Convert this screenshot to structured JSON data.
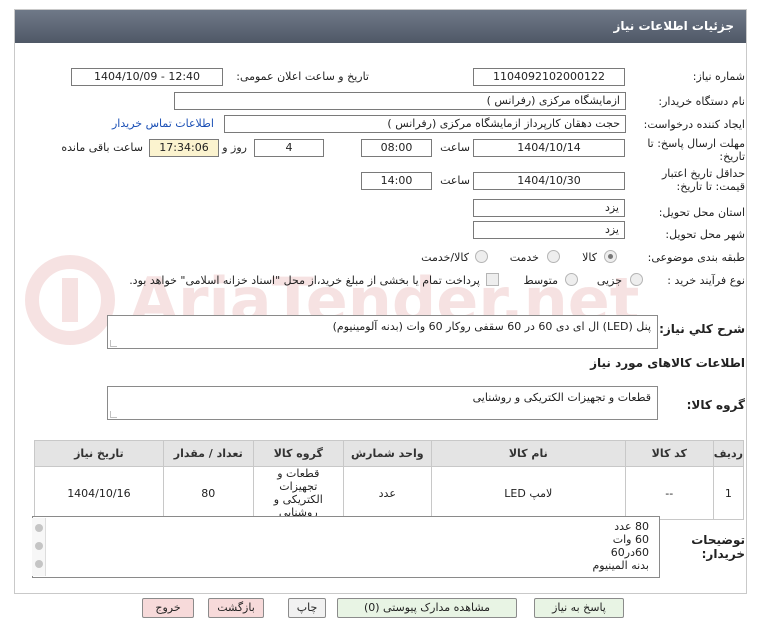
{
  "header": {
    "title": "جزئیات اطلاعات نیاز"
  },
  "form": {
    "need_number_label": "شماره نیاز:",
    "need_number": "1104092102000122",
    "announce_label": "تاریخ و ساعت اعلان عمومی:",
    "announce_value": "1404/10/09 - 12:40",
    "buyer_org_label": "نام دستگاه خریدار:",
    "buyer_org": "ازمایشگاه مرکزی (رفرانس )",
    "creator_label": "ایجاد کننده درخواست:",
    "creator": "حجت دهقان کارپرداز ازمایشگاه مرکزی (رفرانس )",
    "contact_link": "اطلاعات تماس خریدار",
    "deadline_label_1": "مهلت ارسال پاسخ: تا",
    "deadline_label_2": "تاریخ:",
    "deadline_date": "1404/10/14",
    "time_label": "ساعت",
    "deadline_time": "08:00",
    "days_value": "4",
    "days_label": "روز و",
    "remaining_time": "17:34:06",
    "remaining_label": "ساعت باقی مانده",
    "validity_label_1": "حداقل تاریخ اعتبار",
    "validity_label_2": "قیمت: تا تاریخ:",
    "validity_date": "1404/10/30",
    "validity_time_label": "ساعت",
    "validity_time": "14:00",
    "province_label": "استان محل تحویل:",
    "province": "یزد",
    "city_label": "شهر محل تحویل:",
    "city": "یزد",
    "category_label": "طبقه بندی موضوعی:",
    "category_options": [
      "کالا",
      "خدمت",
      "کالا/خدمت"
    ],
    "category_selected": "کالا",
    "purchase_label": "نوع فرآیند خرید :",
    "purchase_options": [
      "جزیی",
      "متوسط"
    ],
    "purchase_note": "پرداخت تمام یا بخشی از مبلغ خرید،از محل \"اسناد خزانه اسلامی\" خواهد بود."
  },
  "description": {
    "label": "شرح کلي نياز:",
    "value": "پنل (LED) ال ای دی 60 در 60 سقفی روکار 60 وات (بدنه آلومینیوم)"
  },
  "goods_section": {
    "title": "اطلاعات کالاهای مورد نیاز"
  },
  "goods_group": {
    "label": "گروه کالا:",
    "value": "قطعات و تجهیزات الکتریکی و روشنایی"
  },
  "table": {
    "headers": [
      "ردیف",
      "کد کالا",
      "نام کالا",
      "واحد شمارش",
      "گروه کالا",
      "تعداد / مقدار",
      "تاریخ نیاز"
    ],
    "rows": [
      {
        "row": "1",
        "code": "--",
        "name": "لامپ LED",
        "unit": "عدد",
        "group": "قطعات و تجهیزات الکتریکی و روشنایی",
        "qty": "80",
        "date": "1404/10/16"
      }
    ]
  },
  "notes": {
    "label_1": "توضیحات",
    "label_2": "خریدار:",
    "lines": [
      "80 عدد",
      "60 وات",
      "60در60",
      "بدنه المینیوم"
    ]
  },
  "buttons": {
    "reply": "پاسخ به نیاز",
    "attachments": "مشاهده مدارک پیوستی (0)",
    "print": "چاپ",
    "back": "بازگشت",
    "exit": "خروج"
  },
  "watermark": {
    "text": "AriaTender.net"
  }
}
